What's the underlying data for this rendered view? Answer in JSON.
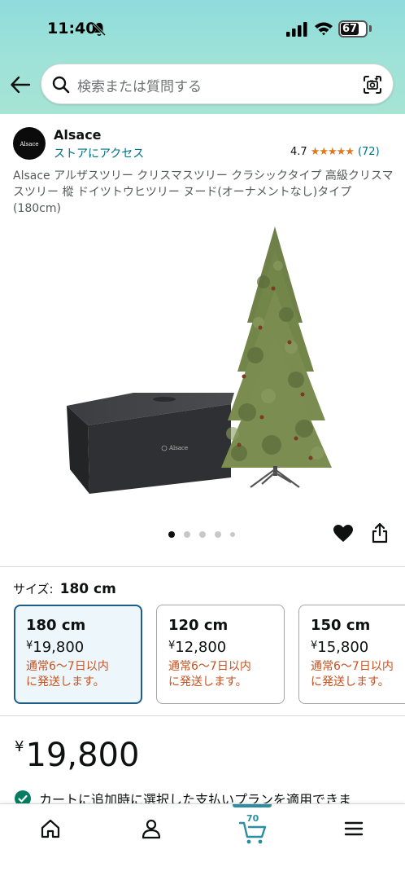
{
  "status_bar": {
    "time": "11:40",
    "battery": "67"
  },
  "search": {
    "placeholder": "検索または質問する"
  },
  "brand": {
    "logo_text": "Alsace",
    "name": "Alsace",
    "store_link": "ストアにアクセス"
  },
  "rating": {
    "value": "4.7",
    "stars": 4.7,
    "count": "(72)"
  },
  "product": {
    "title": "Alsace アルザスツリー クリスマスツリー クラシックタイプ 高級クリスマスツリー 樅 ドイツトウヒツリー ヌード(オーナメントなし)タイプ (180cm)",
    "box_label": "Alsace",
    "image_count": 5,
    "active_image_index": 0
  },
  "size": {
    "label": "サイズ:",
    "selected": "180 cm",
    "options": [
      {
        "size": "180 cm",
        "yen": "¥",
        "price": "19,800",
        "ship_line1": "通常6～7日以内",
        "ship_line2": "に発送します。"
      },
      {
        "size": "120 cm",
        "yen": "¥",
        "price": "12,800",
        "ship_line1": "通常6～7日以内",
        "ship_line2": "に発送します。"
      },
      {
        "size": "150 cm",
        "yen": "¥",
        "price": "15,800",
        "ship_line1": "通常6～7日以内",
        "ship_line2": "に発送します。"
      }
    ]
  },
  "price": {
    "yen": "¥",
    "amount": "19,800"
  },
  "payment_note": "カートに追加時に選択した支払いプランを適用できま",
  "nav": {
    "cart_count": "70"
  },
  "colors": {
    "link": "#007185",
    "star": "#de7921",
    "shipping": "#c7511f",
    "selected_border": "#1f5d89",
    "accent": "#2a8ea0"
  }
}
